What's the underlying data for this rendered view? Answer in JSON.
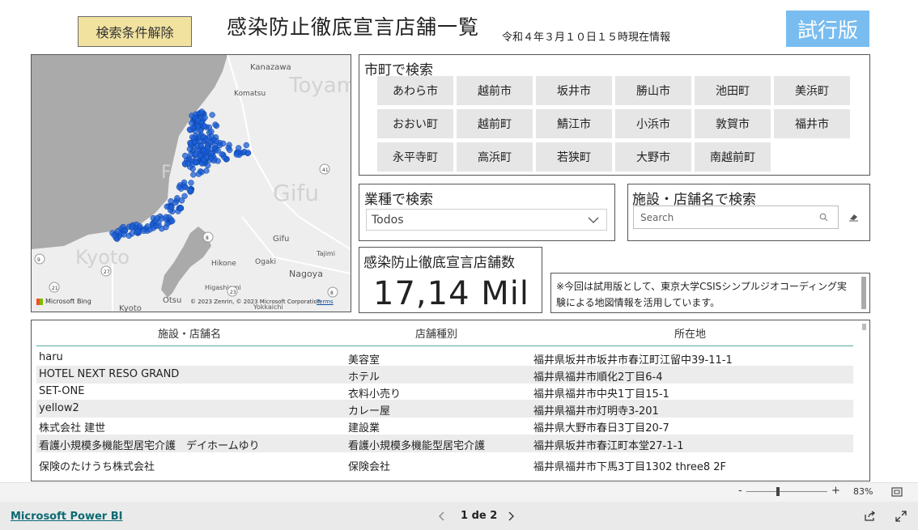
{
  "header": {
    "reset_label": "検索条件解除",
    "title": "感染防止徹底宣言店舗一覧",
    "as_of": "令和４年３月１０日１５時現在情報",
    "trial_label": "試行版"
  },
  "map": {
    "labels": [
      "Kanazawa",
      "Toyam",
      "Komatsu",
      "Gifu",
      "Gifu",
      "Kyoto",
      "Hikone",
      "Ogaki",
      "Nagoya",
      "Tajimi",
      "Higashiomi",
      "Otsu",
      "Kyoto",
      "Yokkaichi",
      "F"
    ],
    "road_numbers": [
      "41",
      "8",
      "9",
      "27",
      "21",
      "23",
      "8"
    ],
    "attribution": "© 2023 Zenrin, © 2023 Microsoft Corporation",
    "terms": "Terms",
    "bing": "Microsoft Bing",
    "point_color": "#1a5fd8"
  },
  "city_search": {
    "title": "市町で検索",
    "cities": [
      "あわら市",
      "越前市",
      "坂井市",
      "勝山市",
      "池田町",
      "美浜町",
      "おおい町",
      "越前町",
      "鯖江市",
      "小浜市",
      "敦賀市",
      "福井市",
      "永平寺町",
      "高浜町",
      "若狭町",
      "大野市",
      "南越前町"
    ]
  },
  "industry_search": {
    "title": "業種で検索",
    "selected": "Todos"
  },
  "name_search": {
    "title": "施設・店舗名で検索",
    "placeholder": "Search"
  },
  "count": {
    "title": "感染防止徹底宣言店舗数",
    "value": "17,14 Mil"
  },
  "note": {
    "text": "※今回は試用版として、東京大学CSISシンプルジオコーディング実験による地図情報を活用しています。"
  },
  "table": {
    "headers": [
      "施設・店舗名",
      "店舗種別",
      "所在地"
    ],
    "rows": [
      [
        "haru",
        "美容室",
        "福井県坂井市坂井市春江町江留中39-11-1"
      ],
      [
        "HOTEL NEXT RESO GRAND",
        "ホテル",
        "福井県福井市順化2丁目6-4"
      ],
      [
        "SET-ONE",
        "衣料小売り",
        "福井県福井市中央1丁目15-1"
      ],
      [
        "yellow2",
        "カレー屋",
        "福井県福井市灯明寺3-201"
      ],
      [
        "株式会社 建世",
        "建設業",
        "福井県大野市春日3丁目20-7"
      ],
      [
        "看護小規模多機能型居宅介護　デイホームゆり",
        "看護小規模多機能型居宅介護",
        "福井県坂井市春江町本堂27-1-1"
      ],
      [
        "保険のたけうち株式会社",
        "保険会社",
        "福井県福井市下馬3丁目1302 three8 2F"
      ]
    ]
  },
  "zoom": {
    "minus": "-",
    "plus": "+",
    "level": "83%"
  },
  "footer": {
    "brand": "Microsoft Power BI",
    "page": "1 de 2"
  }
}
